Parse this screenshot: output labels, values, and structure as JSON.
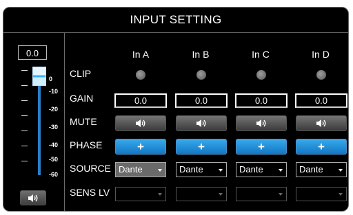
{
  "title": "INPUT SETTING",
  "master": {
    "value": "0.0",
    "scale": [
      "0",
      "-10",
      "-20",
      "-30",
      "-40",
      "-50",
      "-60"
    ],
    "mute_icon": "speaker-icon"
  },
  "row_labels": {
    "clip": "CLIP",
    "gain": "GAIN",
    "mute": "MUTE",
    "phase": "PHASE",
    "source": "SOURCE",
    "sens": "SENS LV"
  },
  "channels": [
    {
      "name": "In A",
      "gain": "0.0",
      "phase": "+",
      "source": "Dante"
    },
    {
      "name": "In B",
      "gain": "0.0",
      "phase": "+",
      "source": "Dante"
    },
    {
      "name": "In C",
      "gain": "0.0",
      "phase": "+",
      "source": "Dante"
    },
    {
      "name": "In D",
      "gain": "0.0",
      "phase": "+",
      "source": "Dante"
    }
  ],
  "colors": {
    "accent": "#2a9ae6",
    "panel_bg": "#000000",
    "border": "#6a6a6a"
  }
}
